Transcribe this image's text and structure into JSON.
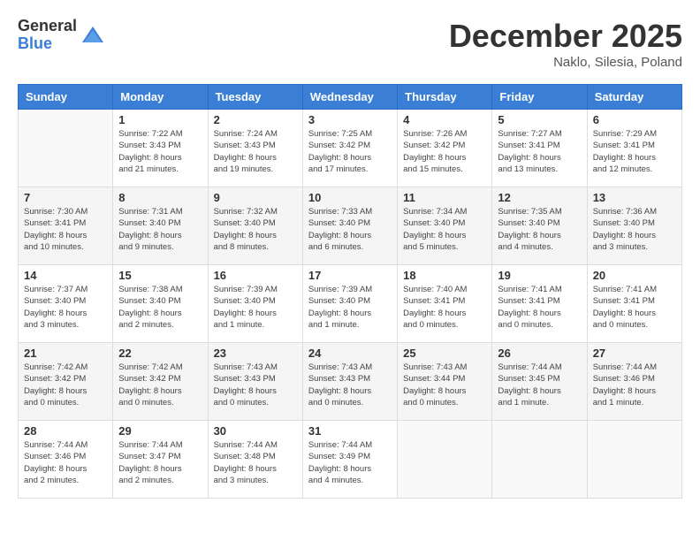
{
  "logo": {
    "general": "General",
    "blue": "Blue"
  },
  "header": {
    "title": "December 2025",
    "location": "Naklo, Silesia, Poland"
  },
  "weekdays": [
    "Sunday",
    "Monday",
    "Tuesday",
    "Wednesday",
    "Thursday",
    "Friday",
    "Saturday"
  ],
  "weeks": [
    [
      {
        "day": "",
        "info": ""
      },
      {
        "day": "1",
        "info": "Sunrise: 7:22 AM\nSunset: 3:43 PM\nDaylight: 8 hours\nand 21 minutes."
      },
      {
        "day": "2",
        "info": "Sunrise: 7:24 AM\nSunset: 3:43 PM\nDaylight: 8 hours\nand 19 minutes."
      },
      {
        "day": "3",
        "info": "Sunrise: 7:25 AM\nSunset: 3:42 PM\nDaylight: 8 hours\nand 17 minutes."
      },
      {
        "day": "4",
        "info": "Sunrise: 7:26 AM\nSunset: 3:42 PM\nDaylight: 8 hours\nand 15 minutes."
      },
      {
        "day": "5",
        "info": "Sunrise: 7:27 AM\nSunset: 3:41 PM\nDaylight: 8 hours\nand 13 minutes."
      },
      {
        "day": "6",
        "info": "Sunrise: 7:29 AM\nSunset: 3:41 PM\nDaylight: 8 hours\nand 12 minutes."
      }
    ],
    [
      {
        "day": "7",
        "info": "Sunrise: 7:30 AM\nSunset: 3:41 PM\nDaylight: 8 hours\nand 10 minutes."
      },
      {
        "day": "8",
        "info": "Sunrise: 7:31 AM\nSunset: 3:40 PM\nDaylight: 8 hours\nand 9 minutes."
      },
      {
        "day": "9",
        "info": "Sunrise: 7:32 AM\nSunset: 3:40 PM\nDaylight: 8 hours\nand 8 minutes."
      },
      {
        "day": "10",
        "info": "Sunrise: 7:33 AM\nSunset: 3:40 PM\nDaylight: 8 hours\nand 6 minutes."
      },
      {
        "day": "11",
        "info": "Sunrise: 7:34 AM\nSunset: 3:40 PM\nDaylight: 8 hours\nand 5 minutes."
      },
      {
        "day": "12",
        "info": "Sunrise: 7:35 AM\nSunset: 3:40 PM\nDaylight: 8 hours\nand 4 minutes."
      },
      {
        "day": "13",
        "info": "Sunrise: 7:36 AM\nSunset: 3:40 PM\nDaylight: 8 hours\nand 3 minutes."
      }
    ],
    [
      {
        "day": "14",
        "info": "Sunrise: 7:37 AM\nSunset: 3:40 PM\nDaylight: 8 hours\nand 3 minutes."
      },
      {
        "day": "15",
        "info": "Sunrise: 7:38 AM\nSunset: 3:40 PM\nDaylight: 8 hours\nand 2 minutes."
      },
      {
        "day": "16",
        "info": "Sunrise: 7:39 AM\nSunset: 3:40 PM\nDaylight: 8 hours\nand 1 minute."
      },
      {
        "day": "17",
        "info": "Sunrise: 7:39 AM\nSunset: 3:40 PM\nDaylight: 8 hours\nand 1 minute."
      },
      {
        "day": "18",
        "info": "Sunrise: 7:40 AM\nSunset: 3:41 PM\nDaylight: 8 hours\nand 0 minutes."
      },
      {
        "day": "19",
        "info": "Sunrise: 7:41 AM\nSunset: 3:41 PM\nDaylight: 8 hours\nand 0 minutes."
      },
      {
        "day": "20",
        "info": "Sunrise: 7:41 AM\nSunset: 3:41 PM\nDaylight: 8 hours\nand 0 minutes."
      }
    ],
    [
      {
        "day": "21",
        "info": "Sunrise: 7:42 AM\nSunset: 3:42 PM\nDaylight: 8 hours\nand 0 minutes."
      },
      {
        "day": "22",
        "info": "Sunrise: 7:42 AM\nSunset: 3:42 PM\nDaylight: 8 hours\nand 0 minutes."
      },
      {
        "day": "23",
        "info": "Sunrise: 7:43 AM\nSunset: 3:43 PM\nDaylight: 8 hours\nand 0 minutes."
      },
      {
        "day": "24",
        "info": "Sunrise: 7:43 AM\nSunset: 3:43 PM\nDaylight: 8 hours\nand 0 minutes."
      },
      {
        "day": "25",
        "info": "Sunrise: 7:43 AM\nSunset: 3:44 PM\nDaylight: 8 hours\nand 0 minutes."
      },
      {
        "day": "26",
        "info": "Sunrise: 7:44 AM\nSunset: 3:45 PM\nDaylight: 8 hours\nand 1 minute."
      },
      {
        "day": "27",
        "info": "Sunrise: 7:44 AM\nSunset: 3:46 PM\nDaylight: 8 hours\nand 1 minute."
      }
    ],
    [
      {
        "day": "28",
        "info": "Sunrise: 7:44 AM\nSunset: 3:46 PM\nDaylight: 8 hours\nand 2 minutes."
      },
      {
        "day": "29",
        "info": "Sunrise: 7:44 AM\nSunset: 3:47 PM\nDaylight: 8 hours\nand 2 minutes."
      },
      {
        "day": "30",
        "info": "Sunrise: 7:44 AM\nSunset: 3:48 PM\nDaylight: 8 hours\nand 3 minutes."
      },
      {
        "day": "31",
        "info": "Sunrise: 7:44 AM\nSunset: 3:49 PM\nDaylight: 8 hours\nand 4 minutes."
      },
      {
        "day": "",
        "info": ""
      },
      {
        "day": "",
        "info": ""
      },
      {
        "day": "",
        "info": ""
      }
    ]
  ]
}
